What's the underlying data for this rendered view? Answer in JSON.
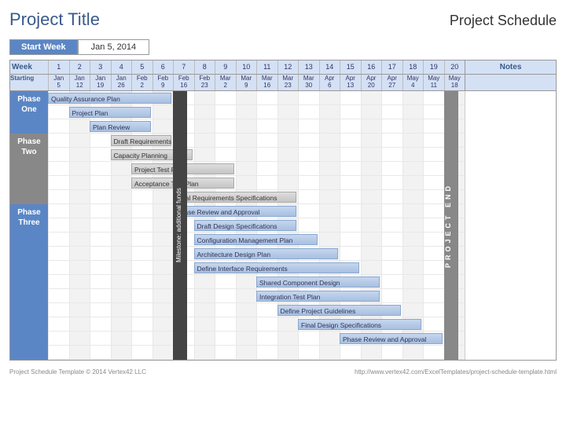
{
  "header": {
    "title": "Project Title",
    "subtitle": "Project Schedule"
  },
  "startweek": {
    "label": "Start Week",
    "value": "Jan 5, 2014"
  },
  "columns": {
    "week_label": "Week",
    "starting_label": "Starting",
    "notes_label": "Notes",
    "weeks": [
      {
        "n": "1",
        "d": "Jan 5"
      },
      {
        "n": "2",
        "d": "Jan 12"
      },
      {
        "n": "3",
        "d": "Jan 19"
      },
      {
        "n": "4",
        "d": "Jan 26"
      },
      {
        "n": "5",
        "d": "Feb 2"
      },
      {
        "n": "6",
        "d": "Feb 9"
      },
      {
        "n": "7",
        "d": "Feb 16"
      },
      {
        "n": "8",
        "d": "Feb 23"
      },
      {
        "n": "9",
        "d": "Mar 2"
      },
      {
        "n": "10",
        "d": "Mar 9"
      },
      {
        "n": "11",
        "d": "Mar 16"
      },
      {
        "n": "12",
        "d": "Mar 23"
      },
      {
        "n": "13",
        "d": "Mar 30"
      },
      {
        "n": "14",
        "d": "Apr 6"
      },
      {
        "n": "15",
        "d": "Apr 13"
      },
      {
        "n": "16",
        "d": "Apr 20"
      },
      {
        "n": "17",
        "d": "Apr 27"
      },
      {
        "n": "18",
        "d": "May 4"
      },
      {
        "n": "19",
        "d": "May 11"
      },
      {
        "n": "20",
        "d": "May 18"
      }
    ]
  },
  "phases": [
    {
      "name": "Phase One",
      "rows": 3,
      "class": "phase-one"
    },
    {
      "name": "Phase Two",
      "rows": 5,
      "class": "phase-two"
    },
    {
      "name": "Phase Three",
      "rows": 11,
      "class": "phase-three"
    }
  ],
  "milestone": {
    "label": "Milestone: additional funds",
    "start": 6,
    "row_start": 0,
    "row_end": 19
  },
  "project_end": {
    "label": "PROJECT END",
    "col": 19,
    "row_start": 0,
    "row_end": 19
  },
  "footer": {
    "left": "Project Schedule Template © 2014 Vertex42 LLC",
    "right": "http://www.vertex42.com/ExcelTemplates/project-schedule-template.html"
  },
  "chart_data": {
    "type": "gantt",
    "title": "Project Schedule",
    "xlabel": "Week",
    "x": [
      1,
      2,
      3,
      4,
      5,
      6,
      7,
      8,
      9,
      10,
      11,
      12,
      13,
      14,
      15,
      16,
      17,
      18,
      19,
      20
    ],
    "tasks": [
      {
        "name": "Quality Assurance Plan",
        "phase": "Phase One",
        "start": 1,
        "duration": 6,
        "color": "blue"
      },
      {
        "name": "Project Plan",
        "phase": "Phase One",
        "start": 2,
        "duration": 4,
        "color": "blue"
      },
      {
        "name": "Plan Review",
        "phase": "Phase One",
        "start": 3,
        "duration": 3,
        "color": "blue"
      },
      {
        "name": "Draft Requirements",
        "phase": "Phase Two",
        "start": 4,
        "duration": 3,
        "color": "gray"
      },
      {
        "name": "Capacity Planning",
        "phase": "Phase Two",
        "start": 4,
        "duration": 4,
        "color": "gray"
      },
      {
        "name": "Project Test Plan",
        "phase": "Phase Two",
        "start": 5,
        "duration": 5,
        "color": "gray"
      },
      {
        "name": "Acceptance Test Plan",
        "phase": "Phase Two",
        "start": 5,
        "duration": 5,
        "color": "gray"
      },
      {
        "name": "Final Requirements Specifications",
        "phase": "Phase Two",
        "start": 7,
        "duration": 6,
        "color": "gray"
      },
      {
        "name": "Phase Review and Approval",
        "phase": "Phase Three",
        "start": 7,
        "duration": 6,
        "color": "blue"
      },
      {
        "name": "Draft Design Specifications",
        "phase": "Phase Three",
        "start": 8,
        "duration": 5,
        "color": "blue"
      },
      {
        "name": "Configuration Management Plan",
        "phase": "Phase Three",
        "start": 8,
        "duration": 6,
        "color": "blue"
      },
      {
        "name": "Architecture Design Plan",
        "phase": "Phase Three",
        "start": 8,
        "duration": 7,
        "color": "blue"
      },
      {
        "name": "Define Interface Requirements",
        "phase": "Phase Three",
        "start": 8,
        "duration": 8,
        "color": "blue"
      },
      {
        "name": "Shared Component Design",
        "phase": "Phase Three",
        "start": 11,
        "duration": 6,
        "color": "blue"
      },
      {
        "name": "Integration Test Plan",
        "phase": "Phase Three",
        "start": 11,
        "duration": 6,
        "color": "blue"
      },
      {
        "name": "Define Project Guidelines",
        "phase": "Phase Three",
        "start": 12,
        "duration": 6,
        "color": "blue"
      },
      {
        "name": "Final Design Specifications",
        "phase": "Phase Three",
        "start": 13,
        "duration": 6,
        "color": "blue"
      },
      {
        "name": "Phase Review and Approval",
        "phase": "Phase Three",
        "start": 15,
        "duration": 5,
        "color": "blue"
      }
    ]
  }
}
